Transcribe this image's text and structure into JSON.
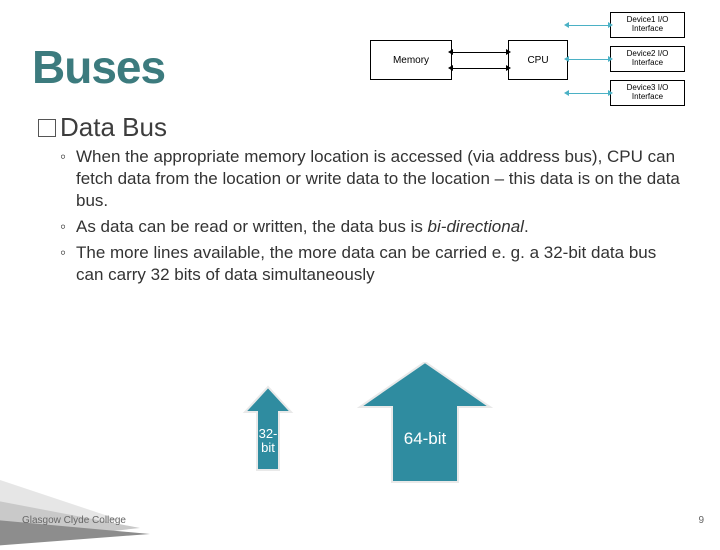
{
  "title": "Buses",
  "diagram": {
    "memory": "Memory",
    "cpu": "CPU",
    "dev1": "Device1 I/O Interface",
    "dev2": "Device2 I/O Interface",
    "dev3": "Device3 I/O Interface"
  },
  "subtitle_prefix": "Data",
  "subtitle_rest": " Bus",
  "bullets": [
    {
      "text": "When the appropriate memory location is accessed (via address bus),  CPU can fetch data from the location or write data to the location – this data is on the data bus."
    },
    {
      "html": "As data can be read or written, the data bus is <em>bi-directional</em>."
    },
    {
      "text": "The more lines available, the more data can be carried e. g. a 32-bit data bus can carry 32 bits of data simultaneously"
    }
  ],
  "arrow_small_label": "32-bit",
  "arrow_large_label": "64-bit",
  "footer": "Glasgow Clyde College",
  "page_number": "9",
  "chart_data": {
    "type": "table",
    "title": "Data bus width comparison (illustrative arrows)",
    "categories": [
      "32-bit",
      "64-bit"
    ],
    "values": [
      32,
      64
    ]
  }
}
